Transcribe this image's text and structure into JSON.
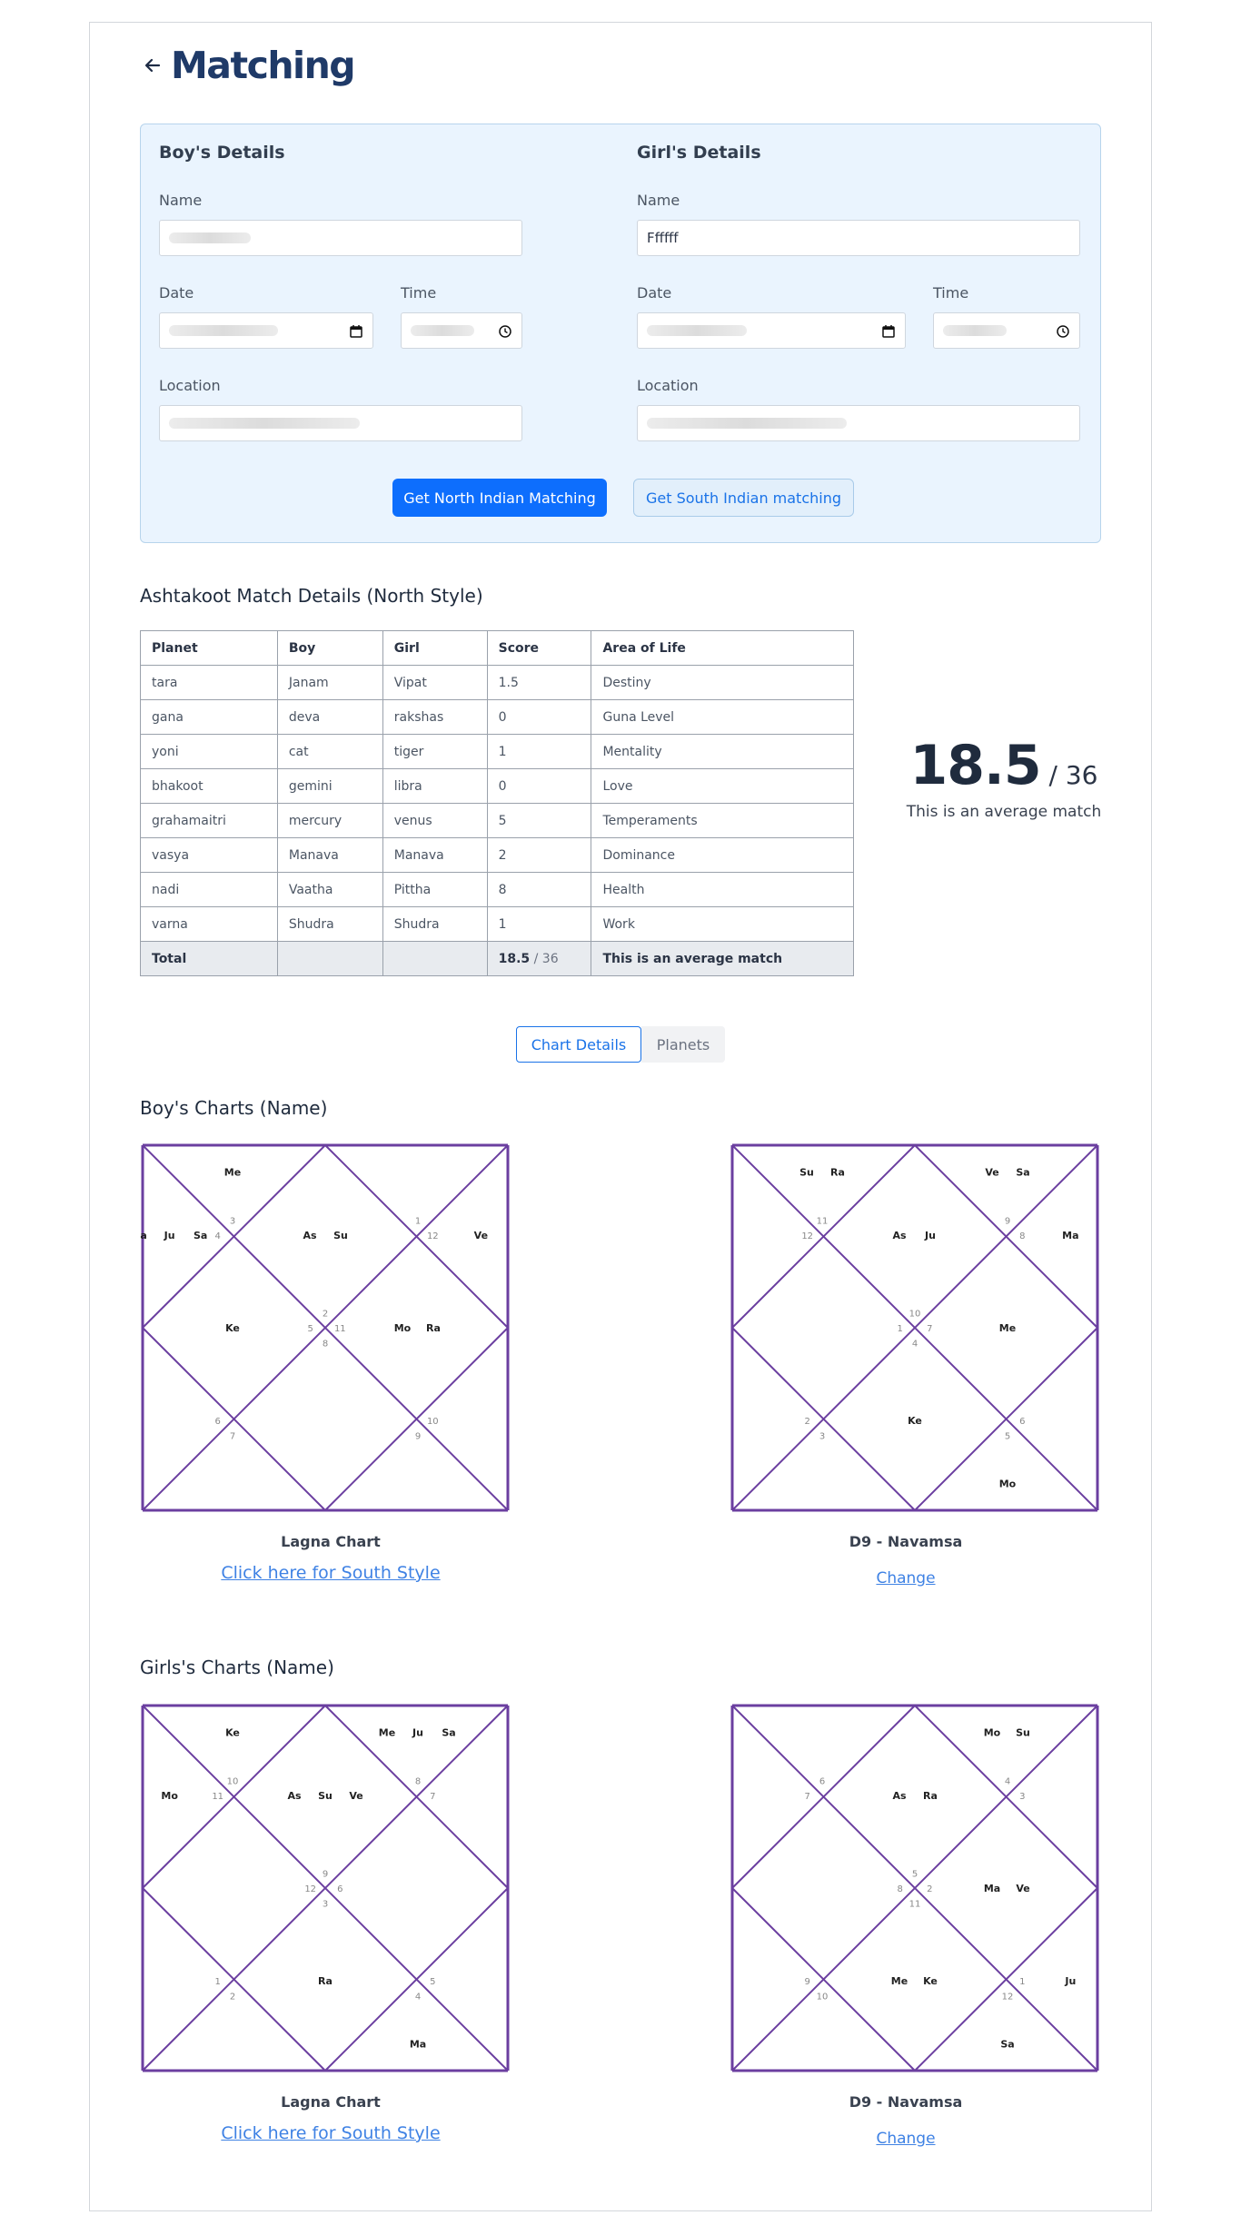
{
  "page": {
    "title": "Matching"
  },
  "form": {
    "boy": {
      "title": "Boy's Details",
      "name_label": "Name",
      "name_value": "",
      "date_label": "Date",
      "time_label": "Time",
      "location_label": "Location"
    },
    "girl": {
      "title": "Girl's Details",
      "name_label": "Name",
      "name_value": "Ffffff",
      "date_label": "Date",
      "time_label": "Time",
      "location_label": "Location"
    },
    "north_button": "Get North Indian Matching",
    "south_button": "Get South Indian matching"
  },
  "ashtakoot": {
    "heading": "Ashtakoot Match Details (North Style)",
    "columns": [
      "Planet",
      "Boy",
      "Girl",
      "Score",
      "Area of Life"
    ],
    "rows": [
      [
        "tara",
        "Janam",
        "Vipat",
        "1.5",
        "Destiny"
      ],
      [
        "gana",
        "deva",
        "rakshas",
        "0",
        "Guna Level"
      ],
      [
        "yoni",
        "cat",
        "tiger",
        "1",
        "Mentality"
      ],
      [
        "bhakoot",
        "gemini",
        "libra",
        "0",
        "Love"
      ],
      [
        "grahamaitri",
        "mercury",
        "venus",
        "5",
        "Temperaments"
      ],
      [
        "vasya",
        "Manava",
        "Manava",
        "2",
        "Dominance"
      ],
      [
        "nadi",
        "Vaatha",
        "Pittha",
        "8",
        "Health"
      ],
      [
        "varna",
        "Shudra",
        "Shudra",
        "1",
        "Work"
      ]
    ],
    "total": {
      "label": "Total",
      "score": "18.5",
      "out_of": " / 36",
      "verdict": "This is an average match"
    }
  },
  "score": {
    "value": "18.5",
    "out_of": " / 36",
    "text": "This is an average match"
  },
  "tabs": {
    "chart_details": "Chart Details",
    "planets": "Planets"
  },
  "boy_charts": {
    "heading": "Boy's Charts (Name)",
    "lagna": {
      "caption": "Lagna Chart",
      "link": "Click here for South Style",
      "houses": [
        {
          "num": "2",
          "planets": [
            "As",
            "Su"
          ]
        },
        {
          "num": "3",
          "planets": [
            "Me"
          ]
        },
        {
          "num": "4",
          "planets": [
            "Ma",
            "Ju",
            "Sa"
          ]
        },
        {
          "num": "5",
          "planets": [
            "Ke"
          ]
        },
        {
          "num": "6",
          "planets": []
        },
        {
          "num": "7",
          "planets": []
        },
        {
          "num": "8",
          "planets": []
        },
        {
          "num": "9",
          "planets": []
        },
        {
          "num": "10",
          "planets": []
        },
        {
          "num": "11",
          "planets": [
            "Mo",
            "Ra"
          ]
        },
        {
          "num": "12",
          "planets": [
            "Ve"
          ]
        },
        {
          "num": "1",
          "planets": []
        }
      ]
    },
    "navamsa": {
      "caption": "D9 - Navamsa",
      "link": "Change",
      "houses": [
        {
          "num": "10",
          "planets": [
            "As",
            "Ju"
          ]
        },
        {
          "num": "11",
          "planets": [
            "Su",
            "Ra"
          ]
        },
        {
          "num": "12",
          "planets": []
        },
        {
          "num": "1",
          "planets": []
        },
        {
          "num": "2",
          "planets": []
        },
        {
          "num": "3",
          "planets": []
        },
        {
          "num": "4",
          "planets": [
            "Ke"
          ]
        },
        {
          "num": "5",
          "planets": [
            "Mo"
          ]
        },
        {
          "num": "6",
          "planets": []
        },
        {
          "num": "7",
          "planets": [
            "Me"
          ]
        },
        {
          "num": "8",
          "planets": [
            "Ma"
          ]
        },
        {
          "num": "9",
          "planets": [
            "Ve",
            "Sa"
          ]
        }
      ]
    }
  },
  "girl_charts": {
    "heading": "Girls's Charts (Name)",
    "lagna": {
      "caption": "Lagna Chart",
      "link": "Click here for South Style",
      "houses": [
        {
          "num": "9",
          "planets": [
            "As",
            "Su",
            "Ve"
          ]
        },
        {
          "num": "10",
          "planets": [
            "Ke"
          ]
        },
        {
          "num": "11",
          "planets": [
            "Mo"
          ]
        },
        {
          "num": "12",
          "planets": []
        },
        {
          "num": "1",
          "planets": []
        },
        {
          "num": "2",
          "planets": []
        },
        {
          "num": "3",
          "planets": [
            "Ra"
          ]
        },
        {
          "num": "4",
          "planets": [
            "Ma"
          ]
        },
        {
          "num": "5",
          "planets": []
        },
        {
          "num": "6",
          "planets": []
        },
        {
          "num": "7",
          "planets": []
        },
        {
          "num": "8",
          "planets": [
            "Me",
            "Ju",
            "Sa"
          ]
        }
      ]
    },
    "navamsa": {
      "caption": "D9 - Navamsa",
      "link": "Change",
      "houses": [
        {
          "num": "5",
          "planets": [
            "As",
            "Ra"
          ]
        },
        {
          "num": "6",
          "planets": []
        },
        {
          "num": "7",
          "planets": []
        },
        {
          "num": "8",
          "planets": []
        },
        {
          "num": "9",
          "planets": []
        },
        {
          "num": "10",
          "planets": []
        },
        {
          "num": "11",
          "planets": [
            "Me",
            "Ke"
          ]
        },
        {
          "num": "12",
          "planets": [
            "Sa"
          ]
        },
        {
          "num": "1",
          "planets": [
            "Ju"
          ]
        },
        {
          "num": "2",
          "planets": [
            "Ma",
            "Ve"
          ]
        },
        {
          "num": "3",
          "planets": []
        },
        {
          "num": "4",
          "planets": [
            "Mo",
            "Su"
          ]
        }
      ]
    }
  }
}
